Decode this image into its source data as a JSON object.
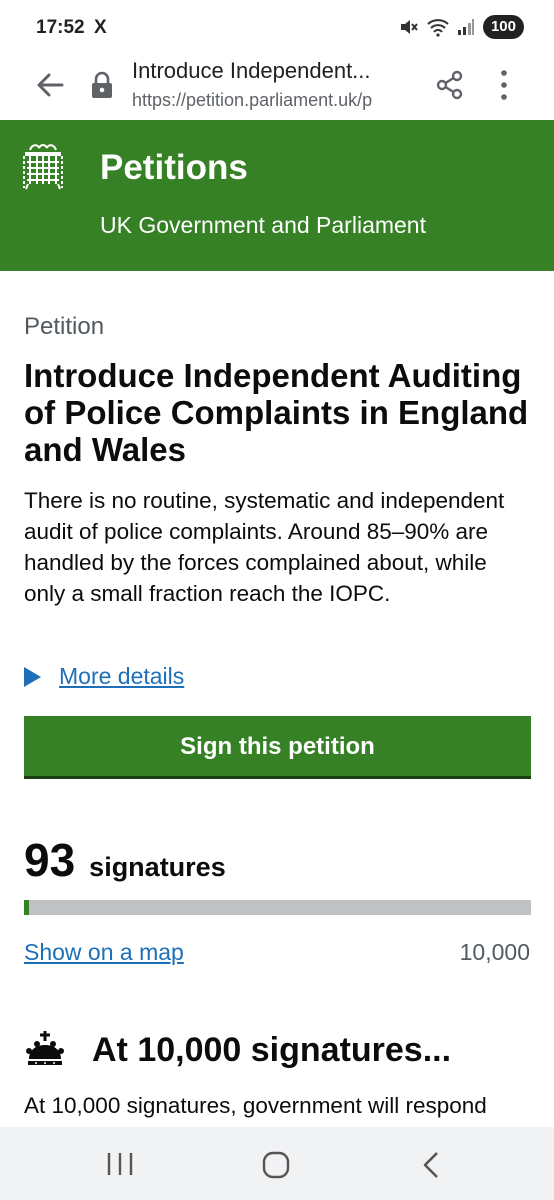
{
  "status_bar": {
    "time": "17:52",
    "app_icon": "X",
    "battery": "100"
  },
  "browser": {
    "page_title": "Introduce Independent...",
    "url": "https://petition.parliament.uk/p"
  },
  "header": {
    "title": "Petitions",
    "subtitle": "UK Government and Parliament"
  },
  "petition": {
    "caption": "Petition",
    "title": "Introduce Independent Auditing of Police Complaints in England and Wales",
    "summary": "There is no routine, systematic and independent audit of police complaints. Around 85–90% are handled by the forces complained about, while only a small fraction reach the IOPC.",
    "more_details": "More details",
    "sign_button": "Sign this petition"
  },
  "signatures": {
    "count": "93",
    "label": "signatures",
    "progress_fraction": 0.0093,
    "map_link": "Show on a map",
    "goal": "10,000"
  },
  "milestone": {
    "title": "At 10,000 signatures...",
    "text": "At 10,000 signatures, government will respond"
  },
  "colors": {
    "brand_green": "#368125",
    "link_blue": "#1d70b8"
  }
}
